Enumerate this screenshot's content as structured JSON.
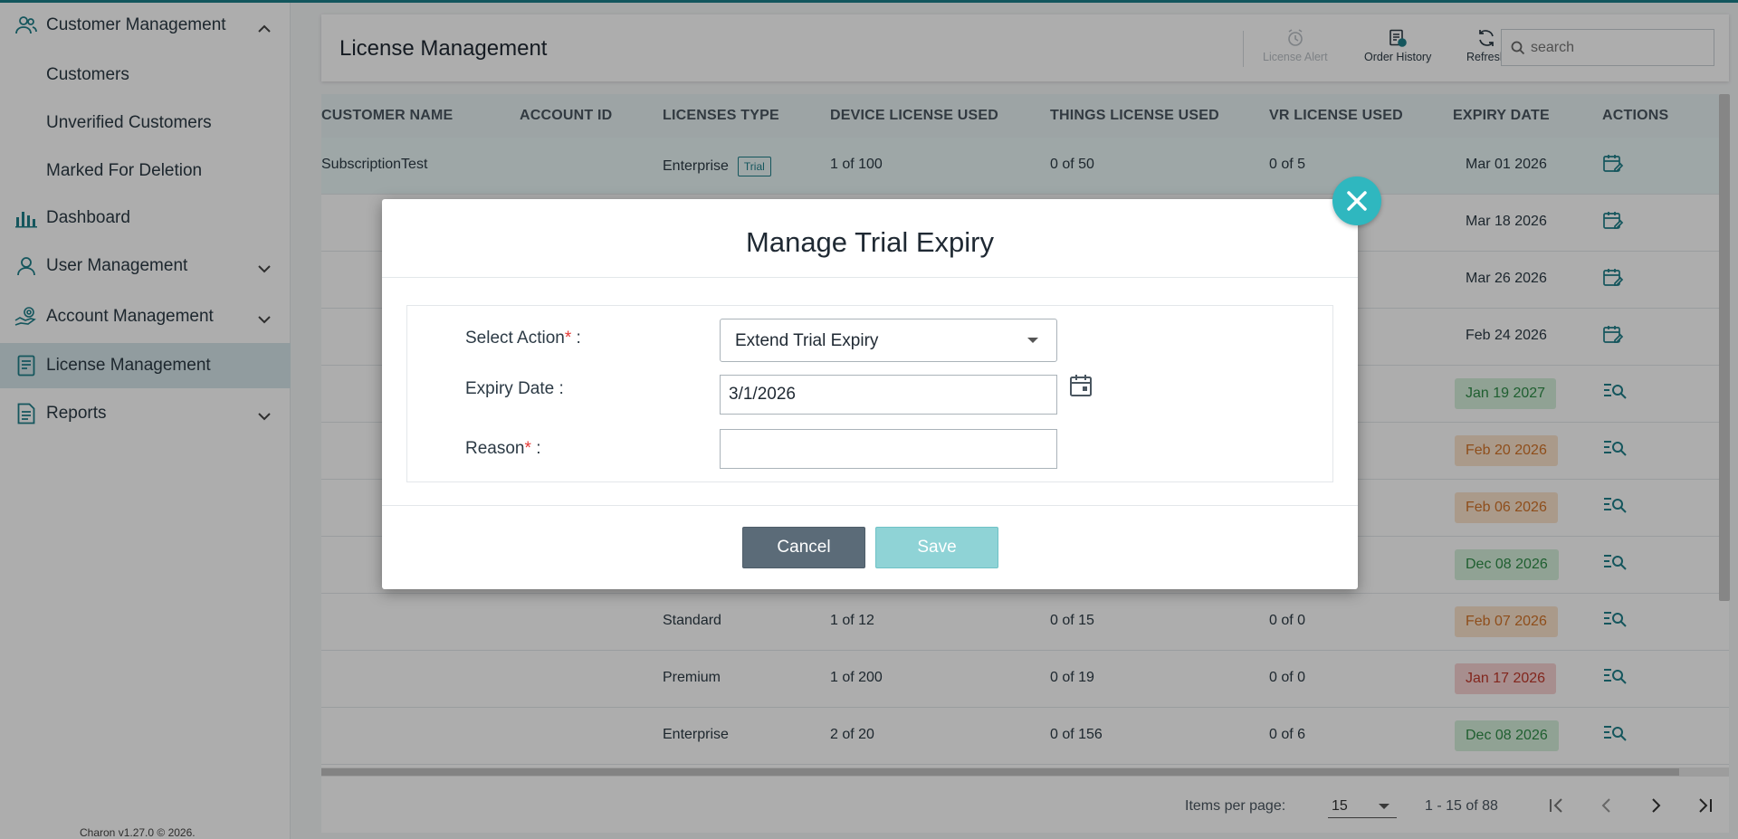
{
  "sidebar": {
    "items": [
      {
        "label": "Customer Management",
        "icon": "users-icon",
        "expanded": true
      },
      {
        "label": "Customers"
      },
      {
        "label": "Unverified Customers"
      },
      {
        "label": "Marked For Deletion"
      },
      {
        "label": "Dashboard",
        "icon": "bar-chart-icon"
      },
      {
        "label": "User Management",
        "icon": "user-icon"
      },
      {
        "label": "Account Management",
        "icon": "account-settings-icon"
      },
      {
        "label": "License Management",
        "icon": "license-doc-icon",
        "active": true
      },
      {
        "label": "Reports",
        "icon": "report-icon"
      }
    ],
    "footer": "Charon v1.27.0 © 2026."
  },
  "header": {
    "title": "License Management",
    "tools": {
      "license_alert": "License Alert",
      "order_history": "Order History",
      "refresh": "Refresh"
    },
    "search_placeholder": "search"
  },
  "table": {
    "columns": [
      "CUSTOMER NAME",
      "ACCOUNT ID",
      "LICENSES TYPE",
      "DEVICE LICENSE USED",
      "THINGS LICENSE USED",
      "VR LICENSE USED",
      "EXPIRY DATE",
      "ACTIONS"
    ],
    "rows": [
      {
        "name": "SubscriptionTest",
        "account": "",
        "type": "Enterprise",
        "trial": "Trial",
        "device": "1 of 100",
        "things": "0 of 50",
        "vr": "0 of 5",
        "expiry": "Mar 01 2026",
        "status": "",
        "action": "calendar-edit-icon"
      },
      {
        "name": "",
        "account": "",
        "type": "",
        "device": "",
        "things": "",
        "vr": "",
        "expiry": "Mar 18 2026",
        "status": "",
        "action": "calendar-edit-icon"
      },
      {
        "name": "",
        "account": "",
        "type": "",
        "device": "",
        "things": "",
        "vr": "",
        "expiry": "Mar 26 2026",
        "status": "",
        "action": "calendar-edit-icon"
      },
      {
        "name": "",
        "account": "",
        "type": "",
        "device": "",
        "things": "",
        "vr": "",
        "expiry": "Feb 24 2026",
        "status": "",
        "action": "calendar-edit-icon"
      },
      {
        "name": "",
        "account": "",
        "type": "",
        "device": "",
        "things": "",
        "vr": "",
        "expiry": "Jan 19 2027",
        "status": "green",
        "action": "view-details-icon"
      },
      {
        "name": "",
        "account": "",
        "type": "",
        "device": "",
        "things": "",
        "vr": "",
        "expiry": "Feb 20 2026",
        "status": "orange",
        "action": "view-details-icon"
      },
      {
        "name": "",
        "account": "",
        "type": "",
        "device": "",
        "things": "",
        "vr": "",
        "expiry": "Feb 06 2026",
        "status": "orange",
        "action": "view-details-icon"
      },
      {
        "name": "",
        "account": "",
        "type": "",
        "device": "",
        "things": "",
        "vr": "",
        "expiry": "Dec 08 2026",
        "status": "green",
        "action": "view-details-icon"
      },
      {
        "name": "",
        "account": "",
        "type": "Standard",
        "device": "1 of 12",
        "things": "0 of 15",
        "vr": "0 of 0",
        "expiry": "Feb 07 2026",
        "status": "orange",
        "action": "view-details-icon"
      },
      {
        "name": "",
        "account": "",
        "type": "Premium",
        "device": "1 of 200",
        "things": "0 of 19",
        "vr": "0 of 0",
        "expiry": "Jan 17 2026",
        "status": "red",
        "action": "view-details-icon"
      },
      {
        "name": "",
        "account": "",
        "type": "Enterprise",
        "device": "2 of 20",
        "things": "0 of 156",
        "vr": "0 of 6",
        "expiry": "Dec 08 2026",
        "status": "green",
        "action": "view-details-icon"
      }
    ]
  },
  "pager": {
    "items_per_page_label": "Items per page:",
    "items_per_page": "15",
    "range": "1 - 15 of 88"
  },
  "modal": {
    "title": "Manage Trial Expiry",
    "select_action_label": "Select Action",
    "select_action_value": "Extend Trial Expiry",
    "expiry_label": "Expiry Date",
    "expiry_value": "3/1/2026",
    "reason_label": "Reason",
    "reason_value": "",
    "required_mark": "*",
    "colon": ":",
    "cancel": "Cancel",
    "save": "Save"
  },
  "colors": {
    "accent": "#1f7f8a",
    "close_button": "#2fb7bf",
    "cancel_button": "#5b6b78",
    "save_button_disabled": "#8fd3d6"
  }
}
